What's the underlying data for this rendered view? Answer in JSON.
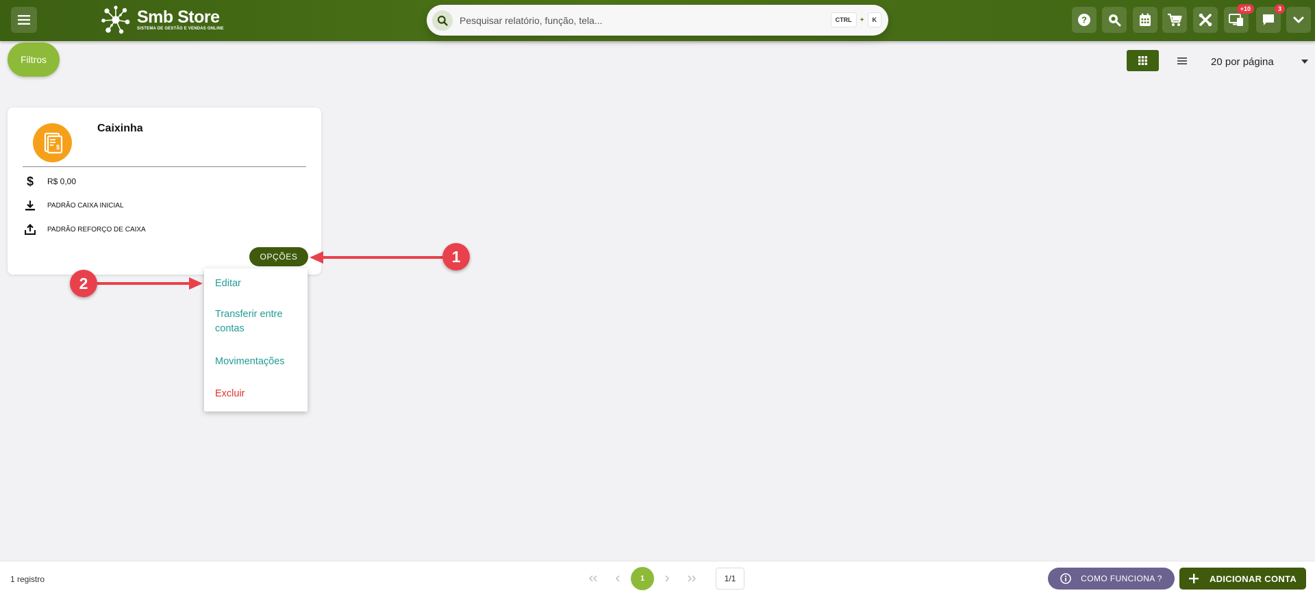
{
  "header": {
    "brand_name": "Smb Store",
    "brand_sub": "Sistema de gestão e vendas online",
    "search_placeholder": "Pesquisar relatório, função, tela...",
    "shortcut_key1": "CTRL",
    "shortcut_plus": "+",
    "shortcut_key2": "K",
    "tools": [
      {
        "icon": "help-icon"
      },
      {
        "icon": "zoom-search-icon"
      },
      {
        "icon": "calendar-icon"
      },
      {
        "icon": "cart-icon"
      },
      {
        "icon": "tools-icon"
      },
      {
        "icon": "monitor-icon",
        "badge": "+10"
      },
      {
        "icon": "chat-icon",
        "badge": "3"
      },
      {
        "icon": "chevron-down-icon"
      }
    ],
    "badge_accent": "#e53945"
  },
  "toolbar": {
    "filters_label": "Filtros",
    "per_page_label": "20 por página"
  },
  "card": {
    "title": "Caixinha",
    "balance": "R$ 0,00",
    "row_initial": "PADRÃO CAIXA INICIAL",
    "row_reinforcement": "PADRÃO REFORÇO DE CAIXA",
    "options_label": "OPÇÕES",
    "avatar_color": "#f6a01a"
  },
  "dropdown": {
    "items": [
      {
        "label": "Editar"
      },
      {
        "label": "Transferir entre contas"
      },
      {
        "label": "Movimentações"
      },
      {
        "label": "Excluir"
      }
    ],
    "item_color": "#239c94",
    "danger_color": "#e0332e"
  },
  "annotations": {
    "marker_1": "1",
    "marker_2": "2",
    "color": "#e8414b"
  },
  "footer": {
    "record_count": "1 registro",
    "current_page": "1",
    "page_info": "1/1",
    "help_label": "COMO FUNCIONA ?",
    "add_label": "ADICIONAR CONTA"
  },
  "colors": {
    "header_green": "#4c7418",
    "dark_green": "#3f5a0c",
    "light_green": "#8dba38",
    "help_purple": "#6b6290"
  }
}
